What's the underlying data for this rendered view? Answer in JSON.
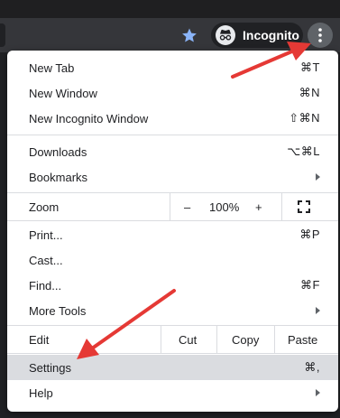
{
  "toolbar": {
    "bookmark_icon": "star-icon",
    "incognito_label": "Incognito",
    "incognito_icon": "incognito-icon",
    "menu_icon": "three-dots-vertical-icon",
    "accent_color": "#8ab4f8"
  },
  "menu": {
    "new_tab": {
      "label": "New Tab",
      "shortcut": "⌘T"
    },
    "new_window": {
      "label": "New Window",
      "shortcut": "⌘N"
    },
    "new_incognito": {
      "label": "New Incognito Window",
      "shortcut": "⇧⌘N"
    },
    "downloads": {
      "label": "Downloads",
      "shortcut": "⌥⌘L"
    },
    "bookmarks": {
      "label": "Bookmarks"
    },
    "zoom": {
      "label": "Zoom",
      "minus": "–",
      "value": "100%",
      "plus": "+"
    },
    "print": {
      "label": "Print...",
      "shortcut": "⌘P"
    },
    "cast": {
      "label": "Cast..."
    },
    "find": {
      "label": "Find...",
      "shortcut": "⌘F"
    },
    "more_tools": {
      "label": "More Tools"
    },
    "edit": {
      "label": "Edit",
      "cut": "Cut",
      "copy": "Copy",
      "paste": "Paste"
    },
    "settings": {
      "label": "Settings",
      "shortcut": "⌘,"
    },
    "help": {
      "label": "Help"
    }
  },
  "annotation": {
    "arrow_color": "#e53935"
  }
}
